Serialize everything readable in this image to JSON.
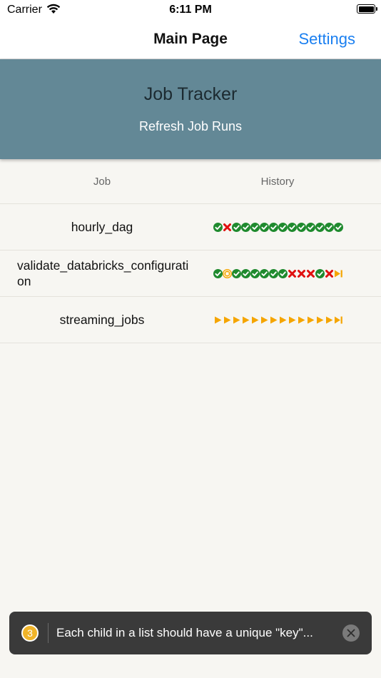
{
  "status": {
    "carrier": "Carrier",
    "time": "6:11 PM"
  },
  "nav": {
    "title": "Main Page",
    "settings_label": "Settings"
  },
  "banner": {
    "title": "Job Tracker",
    "refresh_label": "Refresh Job Runs"
  },
  "table": {
    "headers": {
      "job": "Job",
      "history": "History"
    },
    "rows": [
      {
        "job": "hourly_dag",
        "history": [
          "success",
          "failed",
          "success",
          "success",
          "success",
          "success",
          "success",
          "success",
          "success",
          "success",
          "success",
          "success",
          "success",
          "success"
        ]
      },
      {
        "job": "validate_databricks_configuration",
        "history": [
          "success",
          "stopped",
          "success",
          "success",
          "success",
          "success",
          "success",
          "success",
          "failed",
          "failed",
          "failed",
          "success",
          "failed",
          "skipped"
        ]
      },
      {
        "job": "streaming_jobs",
        "history": [
          "running",
          "running",
          "running",
          "running",
          "running",
          "running",
          "running",
          "running",
          "running",
          "running",
          "running",
          "running",
          "running",
          "skipped"
        ]
      }
    ]
  },
  "toast": {
    "count": "3",
    "message": "Each child in a list should have a unique \"key\"..."
  },
  "colors": {
    "success": "#1f8a2e",
    "failed": "#e01010",
    "running": "#f5a500",
    "banner": "#638896",
    "link": "#1a7ff0"
  }
}
